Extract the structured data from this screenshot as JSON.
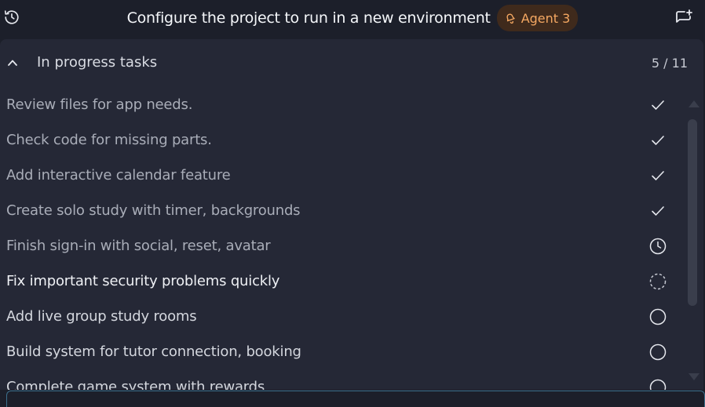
{
  "header": {
    "title": "Configure the project to run in a new environment",
    "agent_badge": "Agent 3",
    "history_icon": "history-icon",
    "new_chat_icon": "new-chat-icon",
    "accent_color": "#f5a862"
  },
  "tasks_panel": {
    "title": "In progress tasks",
    "count": "5 / 11",
    "items": [
      {
        "label": "Review files for app needs.",
        "status": "done",
        "icon": "check-icon"
      },
      {
        "label": "Check code for missing parts.",
        "status": "done",
        "icon": "check-icon"
      },
      {
        "label": "Add interactive calendar feature",
        "status": "done",
        "icon": "check-icon"
      },
      {
        "label": "Create solo study with timer, backgrounds",
        "status": "done",
        "icon": "check-icon"
      },
      {
        "label": "Finish sign-in with social, reset, avatar",
        "status": "done",
        "icon": "clock-icon"
      },
      {
        "label": "Fix important security problems quickly",
        "status": "in-progress",
        "icon": "dashed-circle-icon"
      },
      {
        "label": "Add live group study rooms",
        "status": "pending",
        "icon": "circle-icon"
      },
      {
        "label": "Build system for tutor connection, booking",
        "status": "pending",
        "icon": "circle-icon"
      },
      {
        "label": "Complete game system with rewards",
        "status": "pending",
        "icon": "circle-icon"
      }
    ]
  }
}
